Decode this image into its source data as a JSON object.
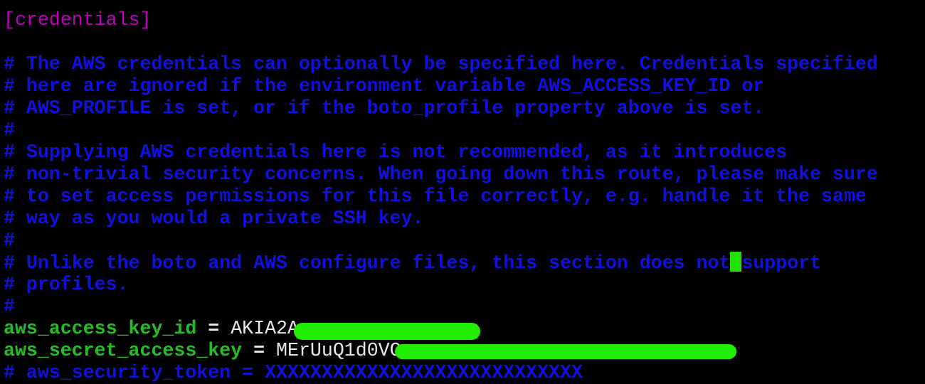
{
  "section_header": "[credentials]",
  "comment_block_1": [
    "# The AWS credentials can optionally be specified here. Credentials specified",
    "# here are ignored if the environment variable AWS_ACCESS_KEY_ID or",
    "# AWS_PROFILE is set, or if the boto_profile property above is set.",
    "#"
  ],
  "comment_block_2": [
    "# Supplying AWS credentials here is not recommended, as it introduces",
    "# non-trivial security concerns. When going down this route, please make sure",
    "# to set access permissions for this file correctly, e.g. handle it the same",
    "# way as you would a private SSH key.",
    "#"
  ],
  "comment_block_3": {
    "line1_before_cursor": "# Unlike the boto and AWS configure files, this section does not",
    "line1_after_cursor": "support",
    "line2": "# profiles.",
    "line3": "#"
  },
  "access_key": {
    "key": "aws_access_key_id",
    "op": " = ",
    "value_visible": "AKIA2A"
  },
  "secret_key": {
    "key": "aws_secret_access_key",
    "op": " = ",
    "value_visible": "MErUuQ1d0VG"
  },
  "security_token_line": "# aws_security_token = XXXXXXXXXXXXXXXXXXXXXXXXXXXX",
  "colors": {
    "background": "#000000",
    "header": "#c000c0",
    "comment": "#1010e0",
    "key": "#22c022",
    "value": "#e8e8e8",
    "cursor": "#22e000",
    "redaction": "#22ee00"
  }
}
